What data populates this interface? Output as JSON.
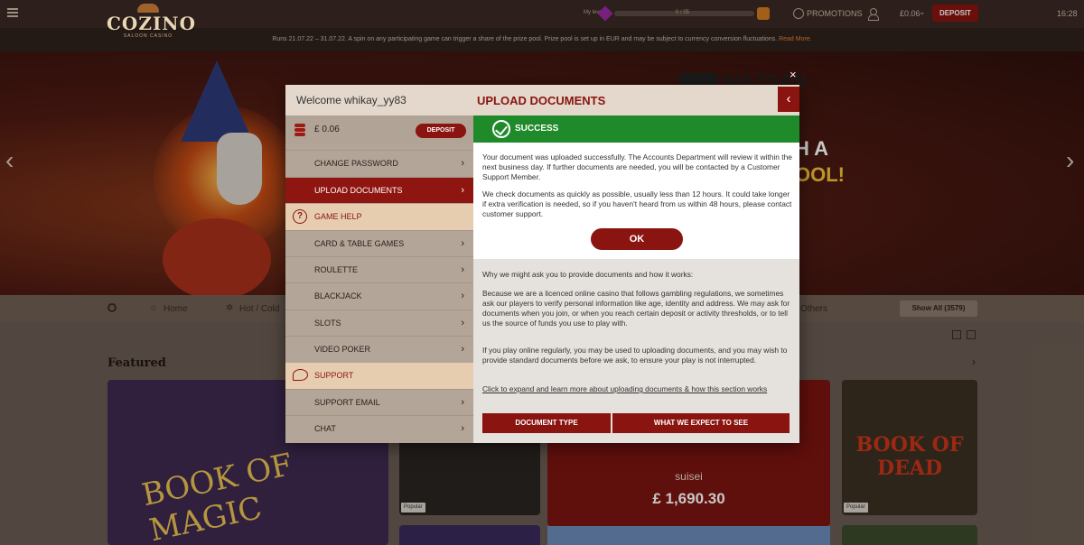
{
  "topbar": {
    "brand": "COZINO",
    "brand_sub": "SALOON CASINO",
    "level_label": "My level",
    "level_count": "0 / 05",
    "promotions": "PROMOTIONS",
    "balance": "£0.06",
    "deposit": "DEPOSIT",
    "time": "16:28"
  },
  "notice": {
    "text": "Runs 21.07.22 – 31.07.22. A spin on any participating game can trigger a share of the prize pool. Prize pool is set up in EUR and may be subject to currency conversion fluctuations.",
    "link": "Read More."
  },
  "hero": {
    "provider": "WAZDAN",
    "line1": "H A",
    "line2": "OOL!"
  },
  "nav": {
    "home": "Home",
    "hot": "Hot / Cold",
    "others": "Others",
    "show_all": "Show All (3579)"
  },
  "featured": {
    "label": "Featured",
    "game1": "BOOK OF MAGIC",
    "jackpot_name": "suisei",
    "jackpot_amount": "£ 1,690.30",
    "game3": "BOOK OF DEAD",
    "popular": "Popular"
  },
  "modal": {
    "welcome": "Welcome whikay_yy83",
    "balance": "£ 0.06",
    "deposit": "DEPOSIT",
    "menu": [
      "CHANGE PASSWORD",
      "UPLOAD DOCUMENTS",
      "GAME HELP",
      "CARD & TABLE GAMES",
      "ROULETTE",
      "BLACKJACK",
      "SLOTS",
      "VIDEO POKER",
      "SUPPORT",
      "SUPPORT EMAIL",
      "CHAT"
    ],
    "title": "UPLOAD DOCUMENTS",
    "success": "SUCCESS",
    "success_p1": "Your document was uploaded successfully. The Accounts Department will review it within the next business day. If further documents are needed, you will be contacted by a Customer Support Member.",
    "success_p2": "We check documents as quickly as possible, usually less than 12 hours. It could take longer if extra verification is needed, so if you haven't heard from us within 48 hours, please contact customer support.",
    "ok": "OK",
    "info_heading": "Why we might ask you to provide documents and how it works:",
    "info_p1": "Because we are a licenced online casino that follows gambling regulations, we sometimes ask our players to verify personal information like age, identity and address. We may ask for documents when you join, or when you reach certain deposit or activity thresholds, or to tell us the source of funds you use to play with.",
    "info_p2": "If you play online regularly, you may be used to uploading documents, and you may wish to provide standard documents before we ask, to ensure your play is not interrupted.",
    "info_link": "Click to expand and learn more about uploading documents & how this section works",
    "doc_type": "DOCUMENT TYPE",
    "expect": "WHAT WE EXPECT TO SEE"
  }
}
